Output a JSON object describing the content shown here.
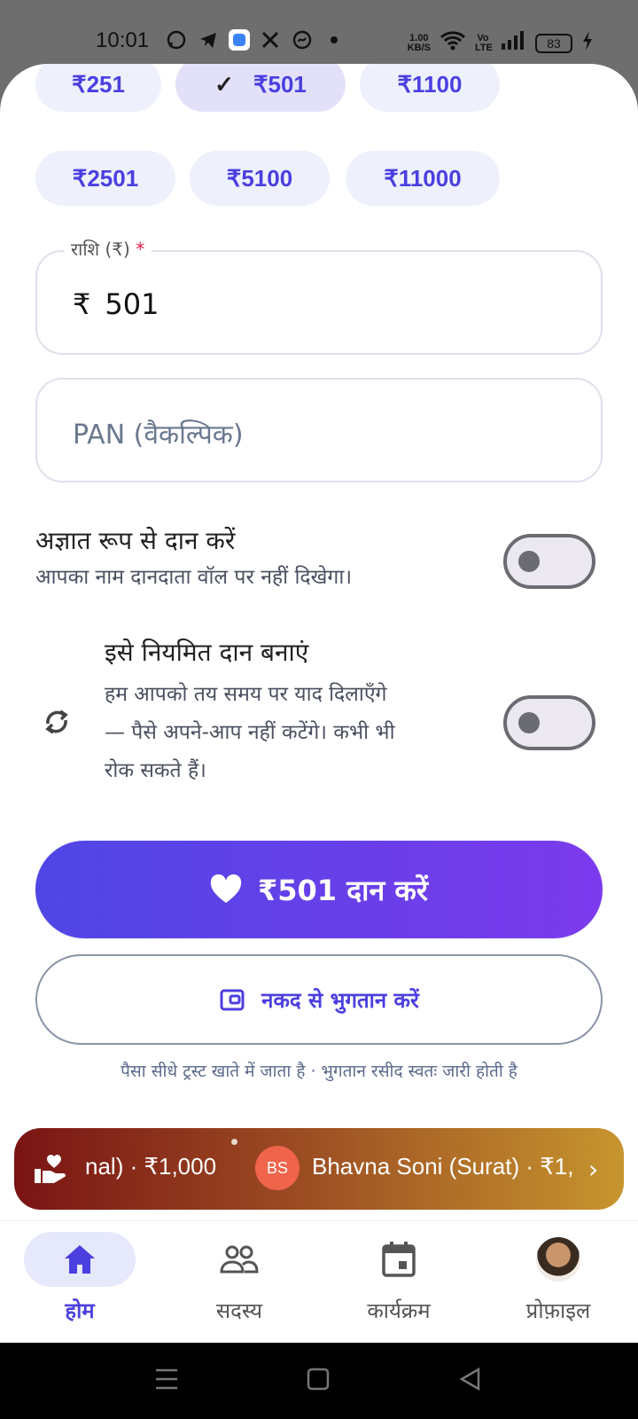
{
  "status_bar": {
    "time": "10:01",
    "speed_top": "1.00",
    "speed_unit": "KB/S",
    "volte": "Vo LTE",
    "battery": "83"
  },
  "amount_chips": [
    {
      "label": "₹251",
      "selected": false
    },
    {
      "label": "₹501",
      "selected": true
    },
    {
      "label": "₹1100",
      "selected": false
    },
    {
      "label": "₹2501",
      "selected": false
    },
    {
      "label": "₹5100",
      "selected": false
    },
    {
      "label": "₹11000",
      "selected": false
    }
  ],
  "amount_field": {
    "label": "राशि (₹)",
    "required_mark": "*",
    "currency_symbol": "₹",
    "value": "501"
  },
  "pan_field": {
    "placeholder": "PAN (वैकल्पिक)"
  },
  "anonymous": {
    "title": "अज्ञात रूप से दान करें",
    "description": "आपका नाम दानदाता वॉल पर नहीं दिखेगा।",
    "enabled": false
  },
  "recurring": {
    "title": "इसे नियमित दान बनाएं",
    "description_lines": [
      "हम आपको तय समय पर याद दिलाएँगे",
      "— पैसे अपने-आप नहीं कटेंगे। कभी भी",
      "रोक सकते हैं।"
    ],
    "enabled": false
  },
  "donate_button": {
    "label": "₹501 दान करें"
  },
  "cash_button": {
    "label": "नकद से भुगतान करें"
  },
  "footnote": "पैसा सीधे ट्रस्ट खाते में जाता है · भुगतान रसीद स्वतः जारी होती है",
  "donor_ticker": {
    "first_text": "nal) · ₹1,000",
    "badge": "BS",
    "second_text": "Bhavna Soni (Surat) · ₹1,"
  },
  "bottom_nav": [
    {
      "label": "होम",
      "icon": "home-icon",
      "active": true
    },
    {
      "label": "सदस्य",
      "icon": "members-icon",
      "active": false
    },
    {
      "label": "कार्यक्रम",
      "icon": "calendar-icon",
      "active": false
    },
    {
      "label": "प्रोफ़ाइल",
      "icon": "avatar",
      "active": false
    }
  ],
  "colors": {
    "accent": "#4b3fe0",
    "button_gradient_start": "#4f46e5",
    "button_gradient_end": "#7c3aed"
  }
}
